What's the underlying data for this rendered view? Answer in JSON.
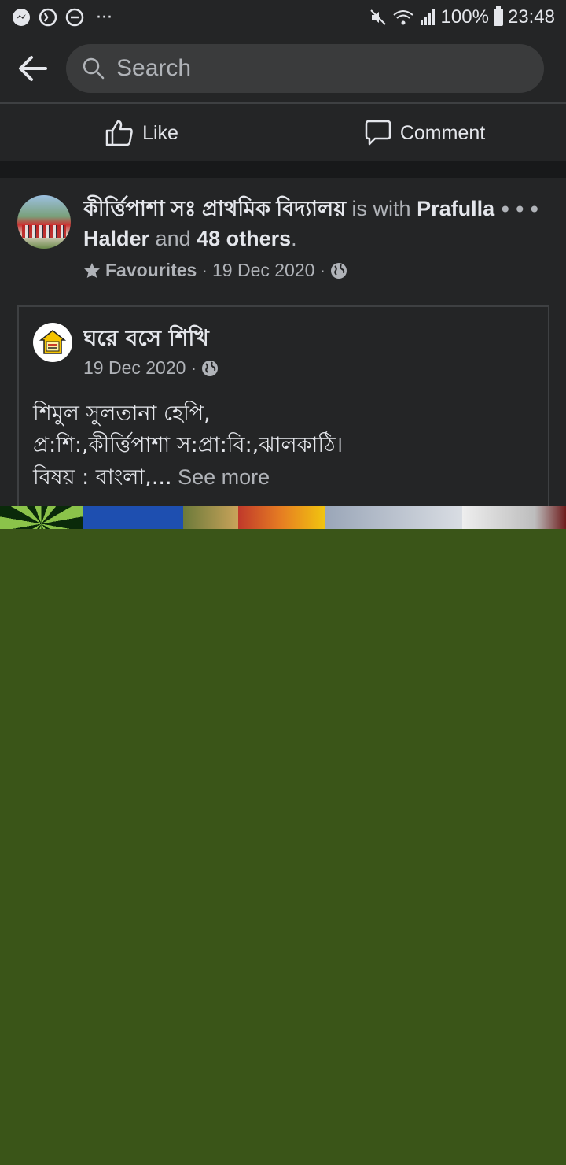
{
  "status_bar": {
    "battery": "100%",
    "time": "23:48",
    "left_icons": [
      "messenger-icon",
      "whatsapp-icon",
      "do-not-disturb-icon",
      "more-dots-icon"
    ],
    "right_icons": [
      "mute-icon",
      "wifi-icon",
      "signal-icon",
      "battery-icon"
    ]
  },
  "toolbar": {
    "search_placeholder": "Search"
  },
  "actions": {
    "like_label": "Like",
    "comment_label": "Comment"
  },
  "post": {
    "author": "কীর্ত্তিপাশা সঃ প্রাথমিক বিদ্যালয়",
    "is_with": " is with ",
    "tagged_person": "Prafulla Halder",
    "and_text": " and ",
    "others": "48 others",
    "period": ".",
    "meta_label": "Favourites",
    "meta_sep": " · ",
    "date": "19 Dec 2020",
    "more_label": "•••"
  },
  "shared_post": {
    "page_name": "ঘরে বসে শিখি",
    "date": "19 Dec 2020",
    "body_line1": "শিমুল সুলতানা হেপি,",
    "body_line2": "প্র:শি:,কীর্ত্তিপাশা স:প্রা:বি:,ঝালকাঠি।",
    "body_line3": "বিষয় : বাংলা,...",
    "see_more": " See more"
  },
  "colors": {
    "background": "#242526",
    "divider": "#18191a",
    "media_green": "#3a5518",
    "text_primary": "#e4e6eb",
    "text_secondary": "#b0b3b8"
  }
}
